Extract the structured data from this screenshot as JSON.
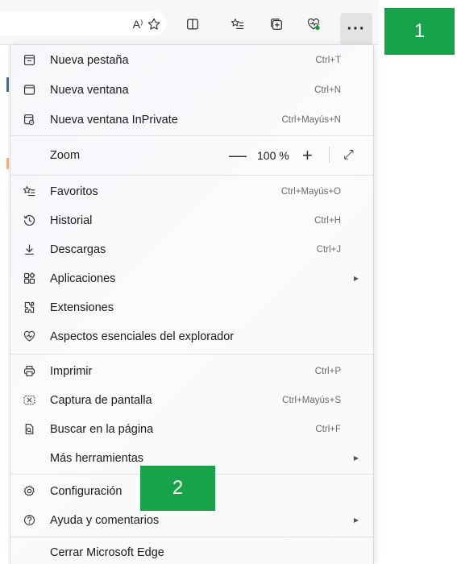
{
  "toolbar": {
    "icons": [
      "read-aloud-icon",
      "favorite-star-icon",
      "split-screen-icon",
      "favorites-list-icon",
      "collections-icon",
      "browser-essentials-icon",
      "more-options-icon"
    ],
    "read_aloud_glyph": "A⁾",
    "more_glyph": "···"
  },
  "callouts": {
    "one": "1",
    "two": "2"
  },
  "colors": {
    "callout": "#16a34a",
    "menu_bg": "#f5f7fa",
    "toolbar_bg": "#f7f7f7"
  },
  "menu": {
    "new_tab": {
      "label": "Nueva pestaña",
      "shortcut": "Ctrl+T"
    },
    "new_window": {
      "label": "Nueva ventana",
      "shortcut": "Ctrl+N"
    },
    "new_inprivate": {
      "label": "Nueva ventana InPrivate",
      "shortcut": "Ctrl+Mayús+N"
    },
    "zoom": {
      "label": "Zoom",
      "minus": "—",
      "value": "100 %",
      "plus": "+",
      "fullscreen": "⤢"
    },
    "favorites": {
      "label": "Favoritos",
      "shortcut": "Ctrl+Mayús+O"
    },
    "history": {
      "label": "Historial",
      "shortcut": "Ctrl+H"
    },
    "downloads": {
      "label": "Descargas",
      "shortcut": "Ctrl+J"
    },
    "apps": {
      "label": "Aplicaciones",
      "arrow": "▶"
    },
    "extensions": {
      "label": "Extensiones"
    },
    "essentials": {
      "label": "Aspectos esenciales del explorador"
    },
    "print": {
      "label": "Imprimir",
      "shortcut": "Ctrl+P"
    },
    "screenshot": {
      "label": "Captura de pantalla",
      "shortcut": "Ctrl+Mayús+S"
    },
    "find": {
      "label": "Buscar en la página",
      "shortcut": "Ctrl+F"
    },
    "more_tools": {
      "label": "Más herramientas",
      "arrow": "▶"
    },
    "settings": {
      "label": "Configuración"
    },
    "help": {
      "label": "Ayuda y comentarios",
      "arrow": "▶"
    },
    "close": {
      "label": "Cerrar Microsoft Edge"
    }
  }
}
